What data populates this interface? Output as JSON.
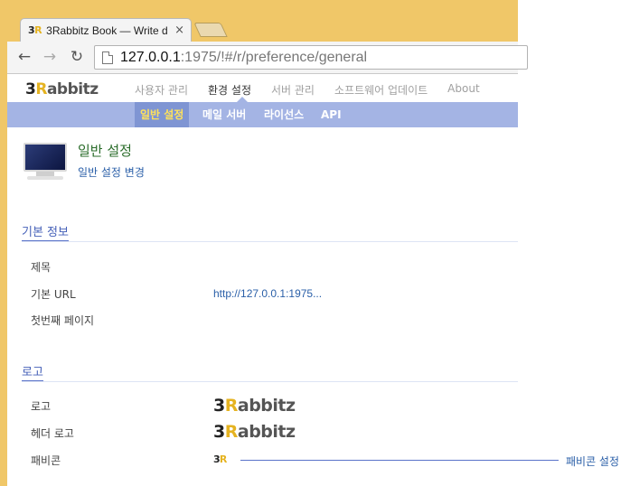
{
  "browser": {
    "tab_logo_prefix": "3",
    "tab_logo_r": "R",
    "tab_title": "3Rabbitz Book — Write d",
    "tab_close": "×",
    "back": "←",
    "forward": "→",
    "reload": "↻",
    "url_host": "127.0.0.1",
    "url_rest": ":1975/!#/r/preference/general"
  },
  "app": {
    "logo_prefix": "3",
    "logo_r": "R",
    "logo_rest": "abbitz",
    "main_nav": [
      "사용자 관리",
      "환경 설정",
      "서버 관리",
      "소프트웨어 업데이트",
      "About"
    ],
    "main_nav_active": "환경 설정",
    "sub_nav": [
      "일반 설정",
      "메일 서버",
      "라이선스",
      "API"
    ],
    "sub_nav_active": "일반 설정"
  },
  "page": {
    "title": "일반 설정",
    "subtitle": "일반 설정 변경"
  },
  "basic_info": {
    "section_title": "기본 정보",
    "rows": [
      {
        "label": "제목",
        "value": ""
      },
      {
        "label": "기본 URL",
        "value": "http://127.0.0.1:1975..."
      },
      {
        "label": "첫번째 페이지",
        "value": ""
      }
    ]
  },
  "logo_section": {
    "section_title": "로고",
    "rows": [
      {
        "label": "로고",
        "logo_prefix": "3",
        "logo_r": "R",
        "logo_rest": "abbitz"
      },
      {
        "label": "헤더 로고",
        "logo_prefix": "3",
        "logo_r": "R",
        "logo_rest": "abbitz"
      },
      {
        "label": "패비콘",
        "logo_prefix": "3",
        "logo_r": "R"
      }
    ],
    "favicon_setting_label": "패비콘 설정"
  },
  "colors": {
    "window_border": "#f0c768",
    "subnav_bg": "#a4b4e4",
    "subnav_active_bg": "#7f95d3",
    "subnav_active_text": "#ffe25a",
    "title_green": "#2b6d2b",
    "link_blue": "#2a5fa8",
    "logo_yellow": "#e5b321"
  }
}
